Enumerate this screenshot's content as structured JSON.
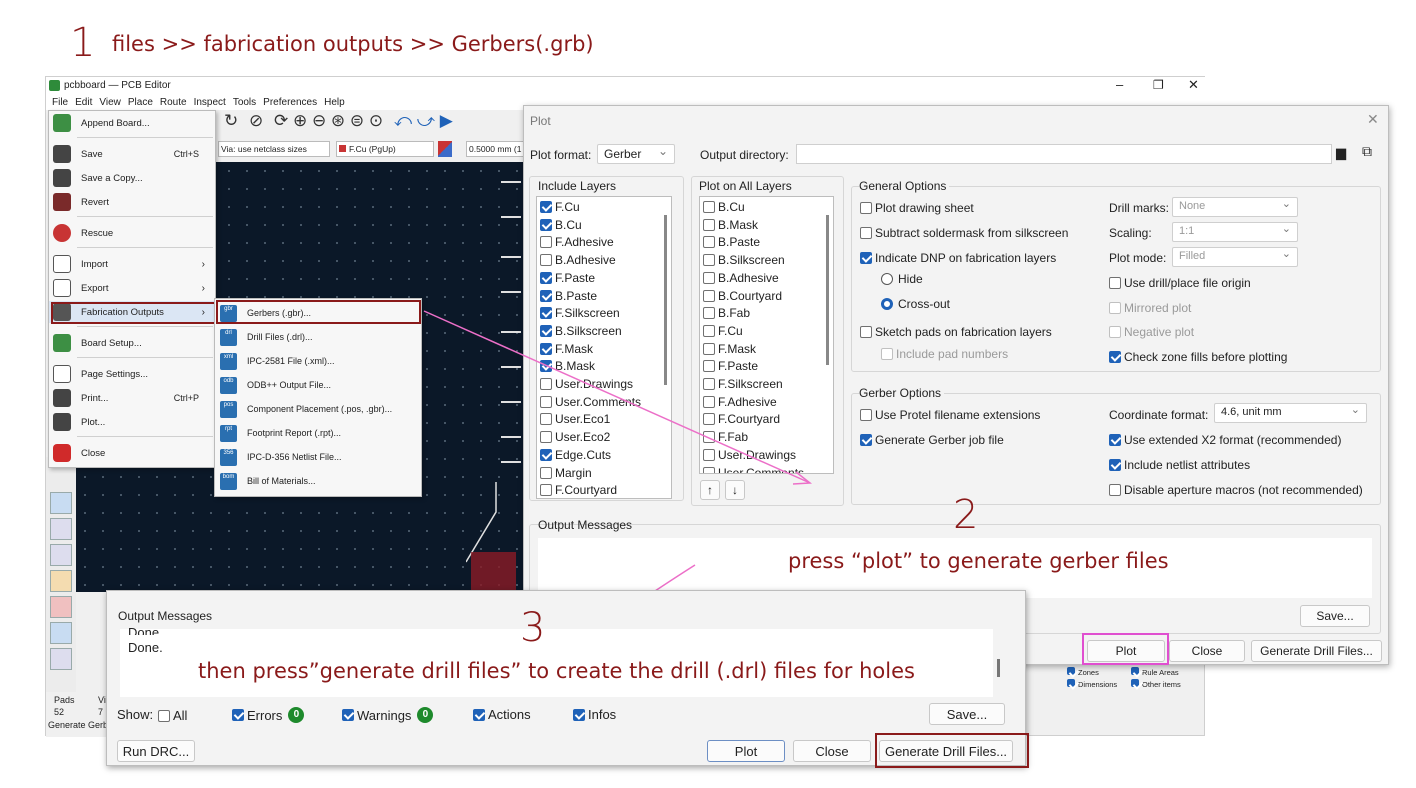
{
  "annotations": {
    "step1_num": "1",
    "step1_text": "files >> fabrication outputs >> Gerbers(.grb)",
    "step2_num": "2",
    "step2_text": "press “plot” to generate gerber files",
    "step3_num": "3",
    "step3_text": "then press”generate drill files” to create the drill (.drl) files for holes",
    "highlight_color": "#8a1a1a",
    "arrow_color": "#ec6fc8",
    "plot_highlight_color": "#e04fd0"
  },
  "editor": {
    "title": "pcbboard — PCB Editor",
    "menu": [
      "File",
      "Edit",
      "View",
      "Place",
      "Route",
      "Inspect",
      "Tools",
      "Preferences",
      "Help"
    ],
    "via_select": "Via: use netclass sizes",
    "layer_select": "F.Cu (PgUp)",
    "grid_value": "0.5000 mm (1",
    "status": {
      "pads_label": "Pads",
      "pads_value": "52",
      "vi_label": "Vi",
      "vi_value": "7",
      "bottom_text": "Generate Gerb"
    },
    "appearance": {
      "zones": "Zones",
      "rule_areas": "Rule Areas",
      "dimensions": "Dimensions",
      "other_items": "Other items"
    }
  },
  "file_menu": [
    {
      "label": "Append Board...",
      "shortcut": "",
      "arrow": false
    },
    {
      "label": "Save",
      "shortcut": "Ctrl+S",
      "arrow": false
    },
    {
      "label": "Save a Copy...",
      "shortcut": "",
      "arrow": false
    },
    {
      "label": "Revert",
      "shortcut": "",
      "arrow": false
    },
    {
      "label": "Rescue",
      "shortcut": "",
      "arrow": false
    },
    {
      "label": "Import",
      "shortcut": "",
      "arrow": true
    },
    {
      "label": "Export",
      "shortcut": "",
      "arrow": true
    },
    {
      "label": "Fabrication Outputs",
      "shortcut": "",
      "arrow": true
    },
    {
      "label": "Board Setup...",
      "shortcut": "",
      "arrow": false
    },
    {
      "label": "Page Settings...",
      "shortcut": "",
      "arrow": false
    },
    {
      "label": "Print...",
      "shortcut": "Ctrl+P",
      "arrow": false
    },
    {
      "label": "Plot...",
      "shortcut": "",
      "arrow": false
    },
    {
      "label": "Close",
      "shortcut": "",
      "arrow": false
    }
  ],
  "fab_submenu": [
    {
      "label": "Gerbers (.gbr)...",
      "icon": "gbr"
    },
    {
      "label": "Drill Files (.drl)...",
      "icon": "drl"
    },
    {
      "label": "IPC-2581 File (.xml)...",
      "icon": "xml"
    },
    {
      "label": "ODB++ Output File...",
      "icon": "odb"
    },
    {
      "label": "Component Placement (.pos, .gbr)...",
      "icon": "pos"
    },
    {
      "label": "Footprint Report (.rpt)...",
      "icon": "rpt"
    },
    {
      "label": "IPC-D-356 Netlist File...",
      "icon": "356"
    },
    {
      "label": "Bill of Materials...",
      "icon": "bom"
    }
  ],
  "plot": {
    "title": "Plot",
    "format_label": "Plot format:",
    "format_value": "Gerber",
    "outdir_label": "Output directory:",
    "include_layers_title": "Include Layers",
    "include_layers": [
      {
        "name": "F.Cu",
        "checked": true
      },
      {
        "name": "B.Cu",
        "checked": true
      },
      {
        "name": "F.Adhesive",
        "checked": false
      },
      {
        "name": "B.Adhesive",
        "checked": false
      },
      {
        "name": "F.Paste",
        "checked": true
      },
      {
        "name": "B.Paste",
        "checked": true
      },
      {
        "name": "F.Silkscreen",
        "checked": true
      },
      {
        "name": "B.Silkscreen",
        "checked": true
      },
      {
        "name": "F.Mask",
        "checked": true
      },
      {
        "name": "B.Mask",
        "checked": true
      },
      {
        "name": "User.Drawings",
        "checked": false
      },
      {
        "name": "User.Comments",
        "checked": false
      },
      {
        "name": "User.Eco1",
        "checked": false
      },
      {
        "name": "User.Eco2",
        "checked": false
      },
      {
        "name": "Edge.Cuts",
        "checked": true
      },
      {
        "name": "Margin",
        "checked": false
      },
      {
        "name": "F.Courtyard",
        "checked": false
      }
    ],
    "all_layers_title": "Plot on All Layers",
    "all_layers": [
      "B.Cu",
      "B.Mask",
      "B.Paste",
      "B.Silkscreen",
      "B.Adhesive",
      "B.Courtyard",
      "B.Fab",
      "F.Cu",
      "F.Mask",
      "F.Paste",
      "F.Silkscreen",
      "F.Adhesive",
      "F.Courtyard",
      "F.Fab",
      "User.Drawings",
      "User.Comments"
    ],
    "general_title": "General Options",
    "plot_drawing_sheet": "Plot drawing sheet",
    "subtract_soldermask": "Subtract soldermask from silkscreen",
    "indicate_dnp": "Indicate DNP on fabrication layers",
    "hide": "Hide",
    "cross_out": "Cross-out",
    "sketch_pads": "Sketch pads on fabrication layers",
    "include_pad_numbers": "Include pad numbers",
    "drill_marks_label": "Drill marks:",
    "drill_marks_value": "None",
    "scaling_label": "Scaling:",
    "scaling_value": "1:1",
    "plot_mode_label": "Plot mode:",
    "plot_mode_value": "Filled",
    "use_drill_origin": "Use drill/place file origin",
    "mirrored_plot": "Mirrored plot",
    "negative_plot": "Negative plot",
    "check_zone_fills": "Check zone fills before plotting",
    "gerber_title": "Gerber Options",
    "protel": "Use Protel filename extensions",
    "gerber_job": "Generate Gerber job file",
    "coord_label": "Coordinate format:",
    "coord_value": "4.6, unit mm",
    "x2": "Use extended X2 format (recommended)",
    "netlist_attr": "Include netlist attributes",
    "aperture": "Disable aperture macros (not recommended)",
    "output_messages": "Output Messages",
    "save": "Save...",
    "plot_btn": "Plot",
    "close_btn": "Close",
    "drill_btn": "Generate Drill Files..."
  },
  "output": {
    "title": "Output Messages",
    "line1": "Done.",
    "line2": "Done.",
    "show_label": "Show:",
    "all": "All",
    "errors": "Errors",
    "errors_count": "0",
    "warnings": "Warnings",
    "warnings_count": "0",
    "actions": "Actions",
    "infos": "Infos",
    "save": "Save...",
    "run_drc": "Run DRC...",
    "plot_btn": "Plot",
    "close_btn": "Close",
    "drill_btn": "Generate Drill Files..."
  }
}
